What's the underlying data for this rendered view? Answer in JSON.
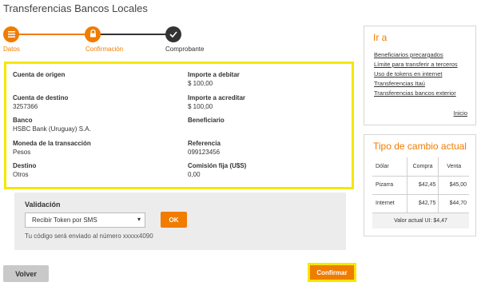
{
  "page": {
    "title": "Transferencias Bancos Locales"
  },
  "stepper": {
    "steps": [
      {
        "label": "Datos",
        "icon": "menu-icon",
        "state": "done"
      },
      {
        "label": "Confirmación",
        "icon": "lock-icon",
        "state": "active"
      },
      {
        "label": "Comprobante",
        "icon": "check-icon",
        "state": "pending"
      }
    ],
    "colors": {
      "accent": "#f07c00",
      "pending": "#333333"
    }
  },
  "summary": {
    "left": [
      {
        "label": "Cuenta de origen",
        "value": ""
      },
      {
        "label": "Cuenta de destino",
        "value": "3257366"
      },
      {
        "label": "Banco",
        "value": "HSBC Bank (Uruguay) S.A."
      },
      {
        "label": "Moneda de la transacción",
        "value": "Pesos"
      },
      {
        "label": "Destino",
        "value": "Otros"
      }
    ],
    "right": [
      {
        "label": "Importe a debitar",
        "value": "$ 100,00"
      },
      {
        "label": "Importe a acreditar",
        "value": "$ 100,00"
      },
      {
        "label": "Beneficiario",
        "value": ""
      },
      {
        "label": "Referencia",
        "value": "099123456"
      },
      {
        "label": "Comisión fija (U$S)",
        "value": "0,00"
      }
    ],
    "highlight_color": "#f5e800"
  },
  "validation": {
    "title": "Validación",
    "select_value": "Recibir Token por SMS",
    "ok_label": "OK",
    "hint": "Tu código será enviado al número xxxxx4090"
  },
  "actions": {
    "back_label": "Volver",
    "confirm_label": "Confirmar"
  },
  "sidebar": {
    "ira": {
      "title": "Ir a",
      "links": [
        "Beneficiarios precargados",
        "Límite para transferir a terceros",
        "Uso de tokens en internet",
        "Transferencias Itaú",
        "Transferencias bancos exterior"
      ],
      "home_link": "Inicio"
    },
    "cambio": {
      "title": "Tipo de cambio actual",
      "headers": [
        "Dólar",
        "Compra",
        "Venta"
      ],
      "rows": [
        {
          "name": "Pizarra",
          "compra": "$42,45",
          "venta": "$45,00"
        },
        {
          "name": "Internet",
          "compra": "$42,75",
          "venta": "$44,70"
        }
      ],
      "footer": "Valor actual UI: $4,47"
    }
  }
}
